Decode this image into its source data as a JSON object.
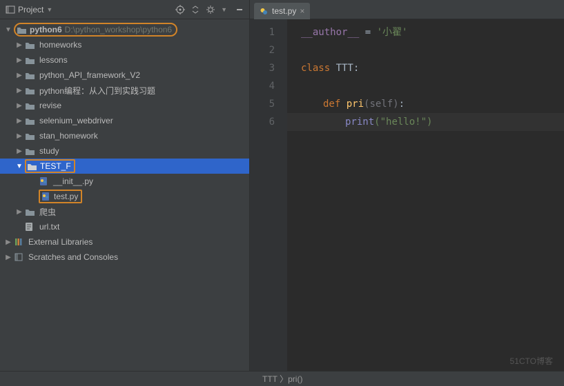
{
  "sidebar": {
    "title": "Project",
    "root": {
      "name": "python6",
      "path": "D:\\python_workshop\\python6"
    },
    "folders": [
      "homeworks",
      "lessons",
      "python_API_framework_V2",
      "python编程：从入门到实践习题",
      "revise",
      "selenium_webdriver",
      "stan_homework",
      "study"
    ],
    "test_folder": "TEST_F",
    "test_files": {
      "init": "__init__.py",
      "test": "test.py"
    },
    "after": {
      "folder": "爬虫",
      "file": "url.txt"
    },
    "external": "External Libraries",
    "scratches": "Scratches and Consoles"
  },
  "editor": {
    "tab": "test.py",
    "lines": [
      "1",
      "2",
      "3",
      "4",
      "5",
      "6"
    ],
    "code": {
      "author_var": "__author__",
      "eq": " = ",
      "author_val": "'小翟'",
      "class_kw": "class ",
      "class_name": "TTT",
      "colon": ":",
      "def_kw": "def ",
      "def_name": "pri",
      "params": "(self)",
      "print_name": "print",
      "print_arg": "(\"hello!\")"
    }
  },
  "breadcrumb": "TTT 〉pri()",
  "watermark": "51CTO博客"
}
